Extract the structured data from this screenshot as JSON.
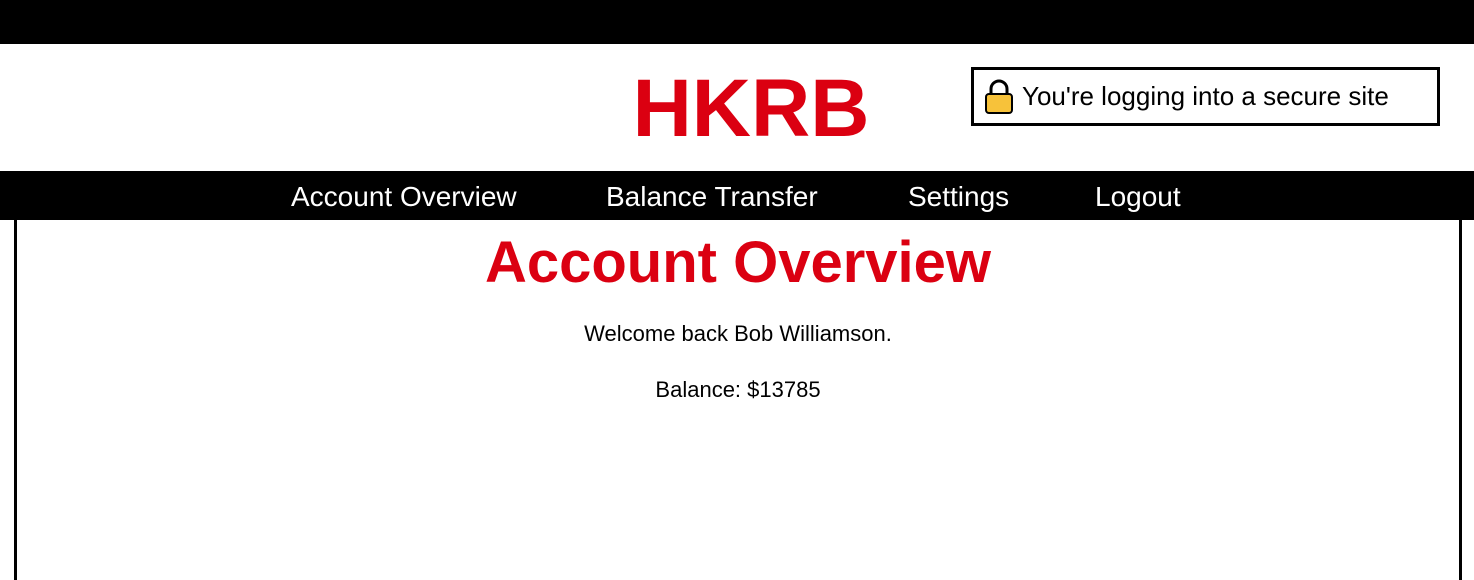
{
  "header": {
    "logo": "HKRB",
    "secure_notice": "You're logging into a secure site",
    "secure_icon": "lock-icon"
  },
  "nav": {
    "items": [
      {
        "label": "Account Overview"
      },
      {
        "label": "Balance Transfer"
      },
      {
        "label": "Settings"
      },
      {
        "label": "Logout"
      }
    ]
  },
  "main": {
    "title": "Account Overview",
    "welcome": "Welcome back Bob Williamson.",
    "balance": "Balance: $13785"
  },
  "colors": {
    "brand_red": "#db0011",
    "bar_black": "#000000",
    "lock_yellow": "#f7c23a"
  }
}
